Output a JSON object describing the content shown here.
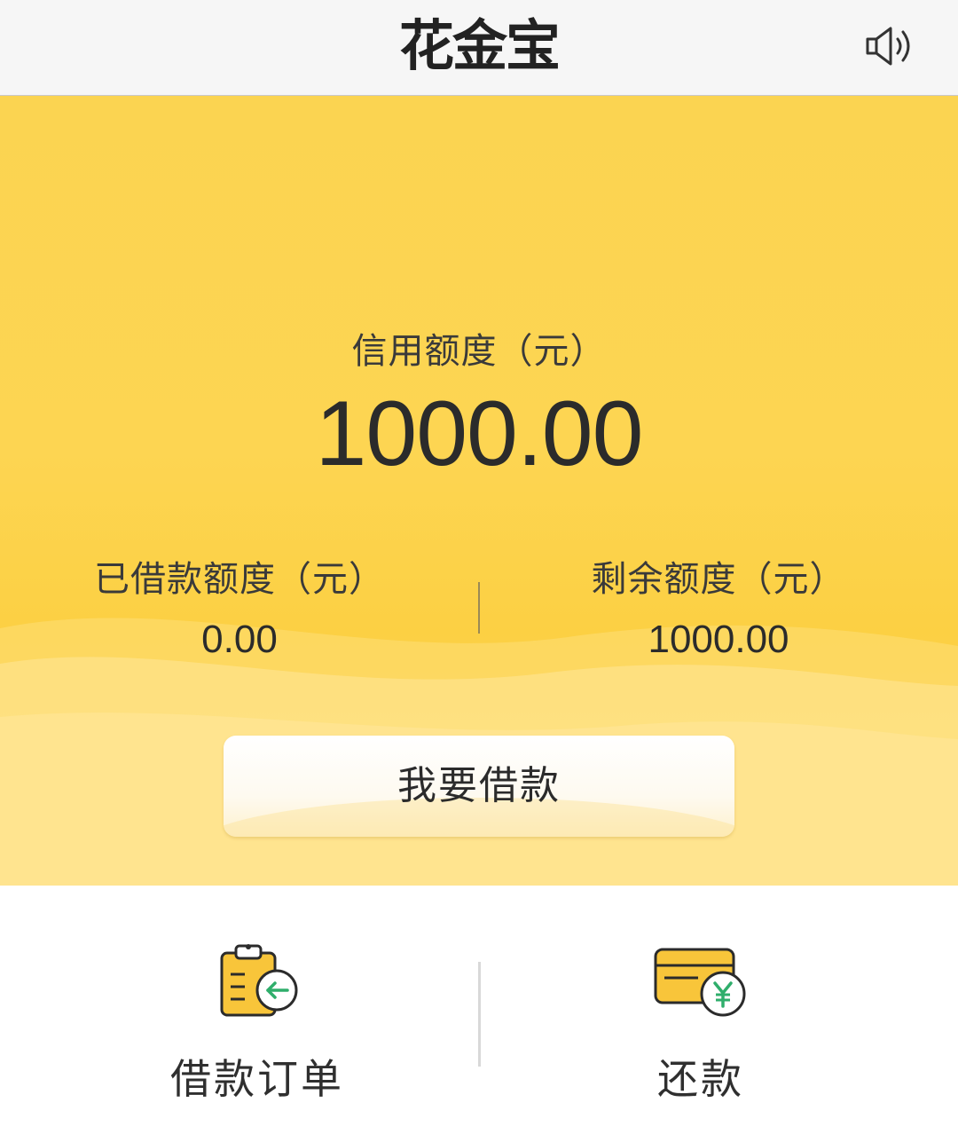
{
  "header": {
    "logo_text": "花金宝",
    "speaker_icon": "speaker-icon"
  },
  "credit": {
    "label": "信用额度（元）",
    "value": "1000.00"
  },
  "borrowed": {
    "label": "已借款额度（元）",
    "value": "0.00"
  },
  "remaining": {
    "label": "剩余额度（元）",
    "value": "1000.00"
  },
  "borrow_button": {
    "label": "我要借款"
  },
  "actions": [
    {
      "label": "借款订单",
      "icon": "clipboard-return-icon"
    },
    {
      "label": "还款",
      "icon": "card-yuan-icon"
    }
  ],
  "colors": {
    "primary": "#fdd552",
    "accent_green": "#2fae6b",
    "icon_outline": "#2b2b2b"
  }
}
